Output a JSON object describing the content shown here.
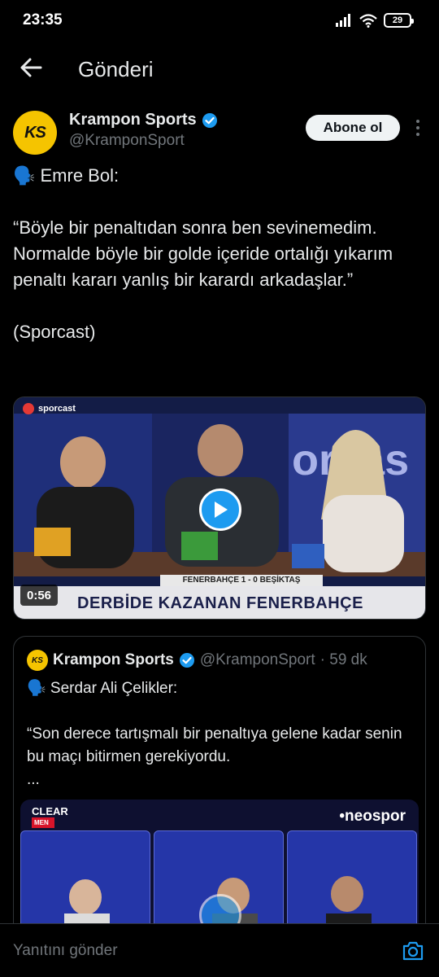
{
  "status": {
    "time": "23:35",
    "battery": "29"
  },
  "nav": {
    "title": "Gönderi"
  },
  "post": {
    "author_name": "Krampon Sports",
    "author_handle": "@KramponSport",
    "avatar_text": "KS",
    "subscribe_label": "Abone ol",
    "line1": "🗣️ Emre Bol:",
    "line2": "“Böyle bir penaltıdan sonra ben sevinemedim. Normalde böyle bir golde içeride ortalığı yıkarım penaltı kararı yanlış bir karardı arkadaşlar.”",
    "line3": "(Sporcast)"
  },
  "video": {
    "duration": "0:56",
    "channel": "sporcast",
    "score_line": "FENERBAHÇE 1 - 0 BEŞİKTAŞ",
    "headline": "DERBİDE KAZANAN FENERBAHÇE"
  },
  "quote": {
    "avatar_text": "KS",
    "name": "Krampon Sports",
    "handle": "@KramponSport",
    "time": "· 59 dk",
    "line1": "🗣️ Serdar Ali Çelikler:",
    "line2": "“Son derece tartışmalı bir penaltıya gelene kadar senin bu maçı bitirmen gerekiyordu.",
    "line3": "...",
    "brand_left": "CLEAR",
    "brand_left_sub": "MEN",
    "brand_right": "•neospor"
  },
  "reply": {
    "placeholder": "Yanıtını gönder"
  },
  "colors": {
    "accent": "#1d9bf0",
    "brand_yellow": "#f5c400",
    "muted": "#71767b"
  },
  "icons": [
    "back-arrow-icon",
    "verified-badge-icon",
    "more-vertical-icon",
    "play-icon",
    "camera-icon",
    "signal-icon",
    "wifi-icon",
    "battery-icon"
  ]
}
